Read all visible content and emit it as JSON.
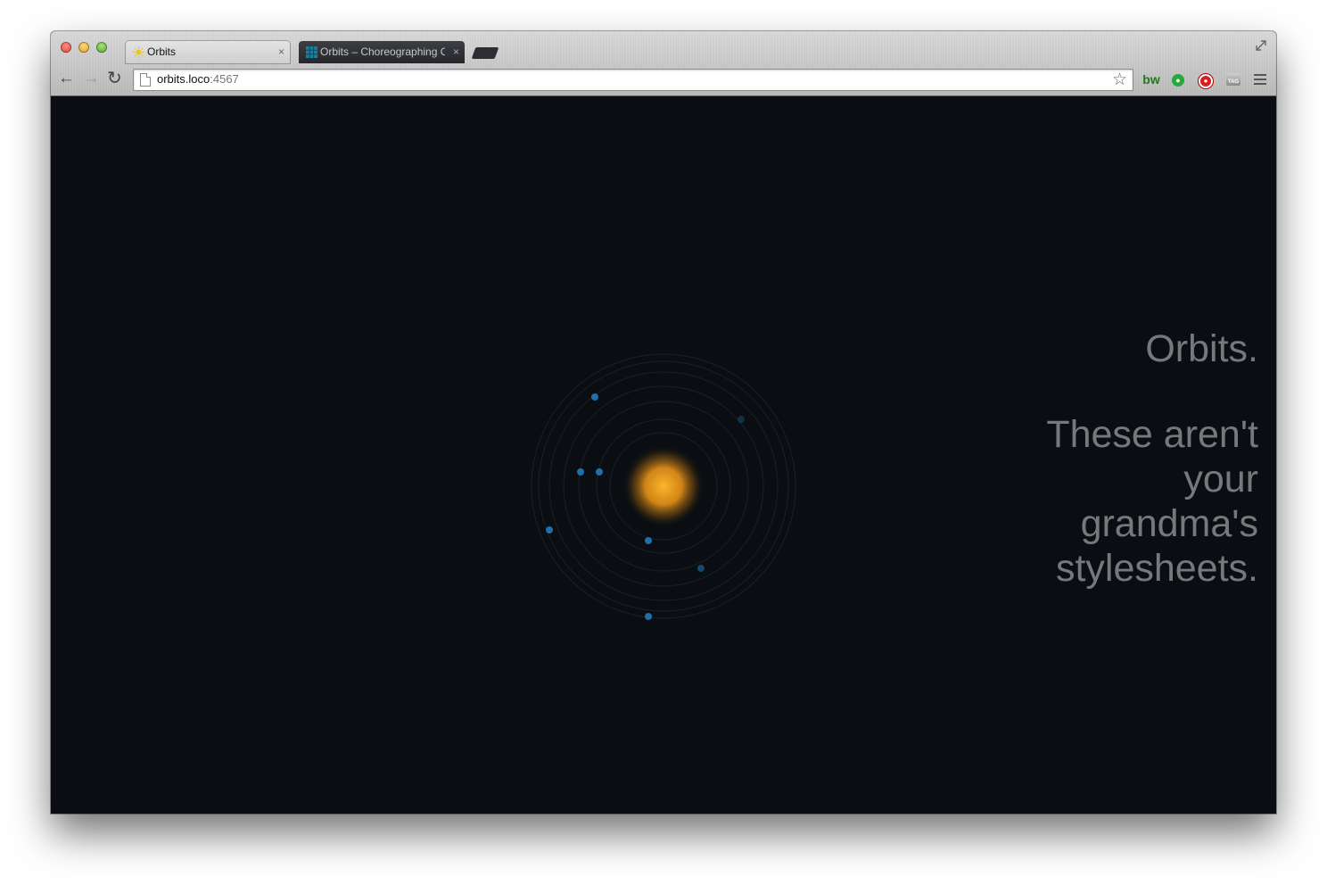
{
  "browser": {
    "tabs": [
      {
        "title": "Orbits",
        "active": true,
        "favicon": "sun-favicon"
      },
      {
        "title": "Orbits – Choreographing C",
        "active": false,
        "favicon": "grid-favicon"
      }
    ],
    "tab_close_glyph": "×",
    "address_bar": {
      "host": "orbits.loco",
      "port": ":4567"
    },
    "extensions": [
      "bw",
      "green-extension",
      "red-extension",
      "TAG"
    ],
    "ext_labels": {
      "bw": "bw",
      "tag": "TAG"
    }
  },
  "page": {
    "title": "Orbits.",
    "tagline": "These aren't your grandma's stylesheets."
  },
  "colors": {
    "background": "#0a0e12",
    "sun": "#f5a623",
    "planet": "#1f6fa8",
    "text": "#76797c",
    "orbit_ring": "#1c2228"
  }
}
